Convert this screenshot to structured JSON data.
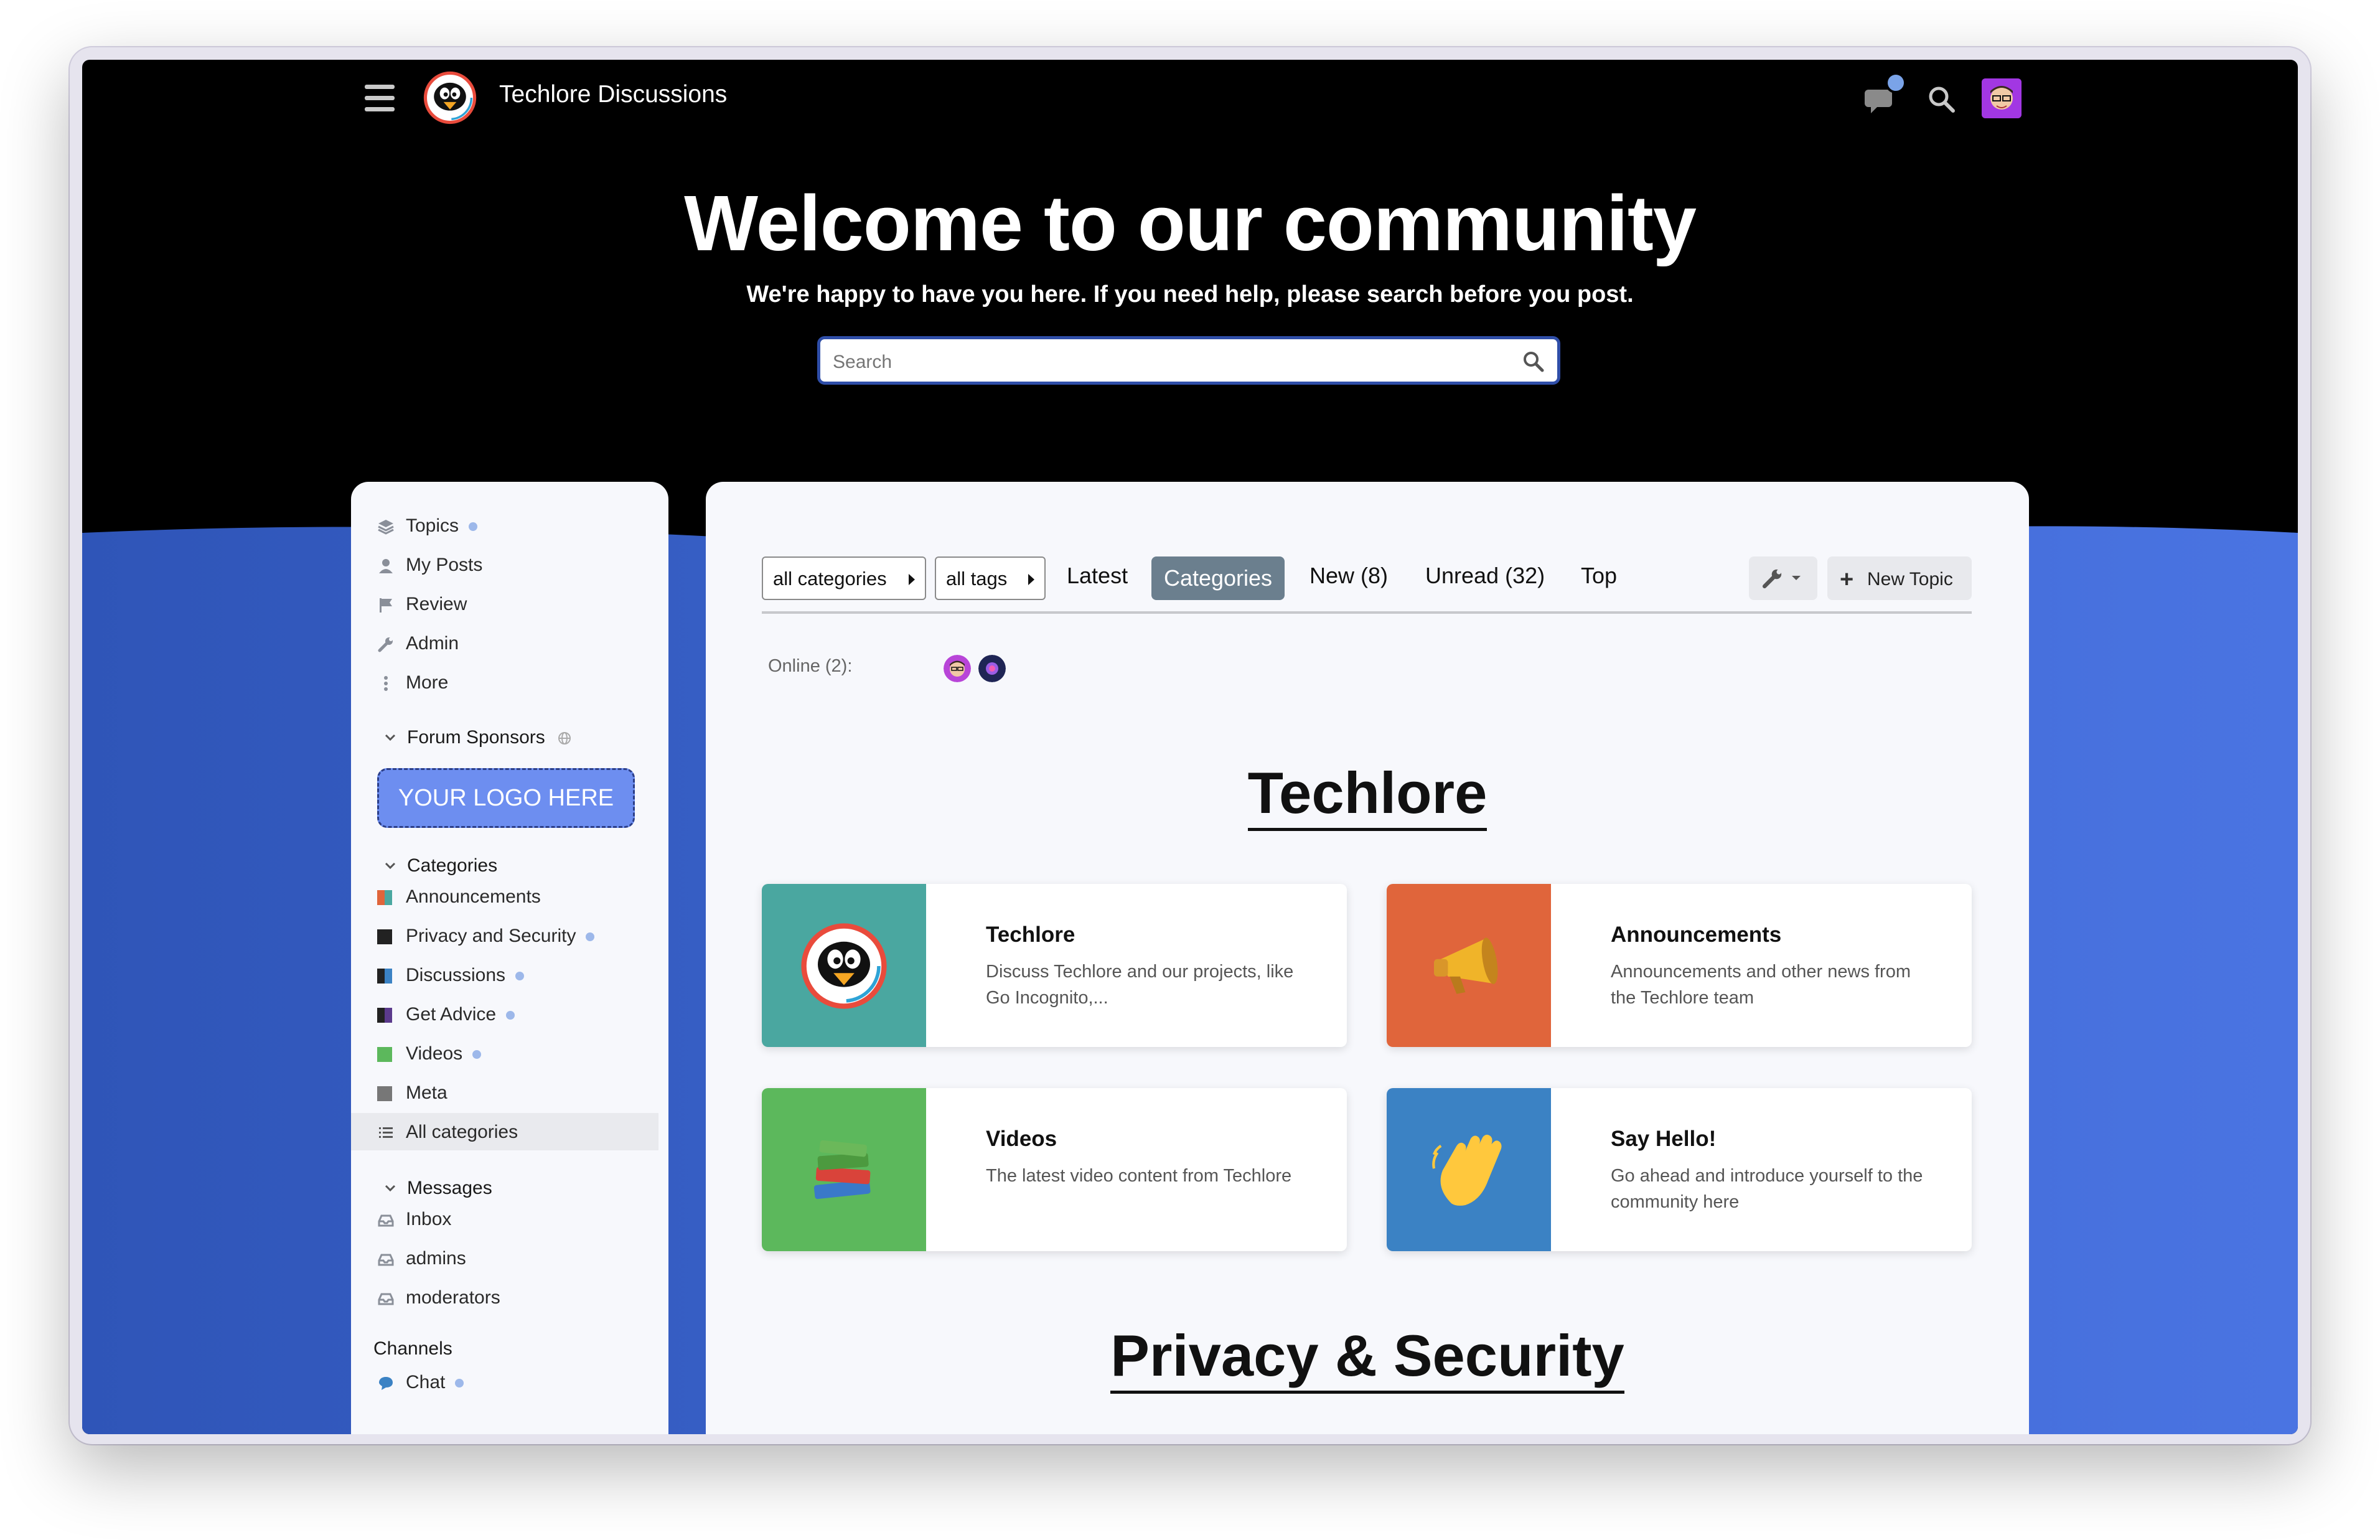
{
  "header": {
    "site_title": "Techlore Discussions"
  },
  "banner": {
    "title": "Welcome to our community",
    "subtitle": "We're happy to have you here. If you need help, please search before you post.",
    "search_placeholder": "Search"
  },
  "sidebar": {
    "top_items": [
      {
        "label": "Topics"
      },
      {
        "label": "My Posts"
      },
      {
        "label": "Review"
      },
      {
        "label": "Admin"
      },
      {
        "label": "More"
      }
    ],
    "sponsors_heading": "Forum Sponsors",
    "logo_promo": "YOUR LOGO HERE",
    "categories_heading": "Categories",
    "categories": [
      {
        "label": "Announcements",
        "color": "#e0653b"
      },
      {
        "label": "Privacy and Security",
        "color": "#222222"
      },
      {
        "label": "Discussions",
        "color": "#3b82c4"
      },
      {
        "label": "Get Advice",
        "color": "#5b3a8c"
      },
      {
        "label": "Videos",
        "color": "#5cb85c"
      },
      {
        "label": "Meta",
        "color": "#777777"
      }
    ],
    "all_categories": "All categories",
    "messages_heading": "Messages",
    "messages": [
      {
        "label": "Inbox"
      },
      {
        "label": "admins"
      },
      {
        "label": "moderators"
      }
    ],
    "channels_heading": "Channels",
    "channels": [
      {
        "label": "Chat"
      }
    ]
  },
  "nav": {
    "all_categories": "all categories",
    "all_tags": "all tags",
    "tabs": [
      "Latest",
      "Categories",
      "New (8)",
      "Unread (32)",
      "Top"
    ],
    "active_tab": "Categories",
    "new_topic": "New Topic"
  },
  "online": {
    "label": "Online (2):"
  },
  "sections": [
    {
      "title": "Techlore",
      "cards": [
        {
          "title": "Techlore",
          "description": "Discuss Techlore and our projects, like Go Incognito,...",
          "color": "#4aa7a0",
          "icon": "penguin-icon"
        },
        {
          "title": "Announcements",
          "description": "Announcements and other news from the Techlore team",
          "color": "#e0653b",
          "icon": "megaphone-icon"
        },
        {
          "title": "Videos",
          "description": "The latest video content from Techlore",
          "color": "#5cb85c",
          "icon": "books-icon"
        },
        {
          "title": "Say Hello!",
          "description": "Go ahead and introduce yourself to the community here",
          "color": "#3b82c4",
          "icon": "waving-hand-icon"
        }
      ]
    },
    {
      "title": "Privacy & Security"
    }
  ],
  "colors": {
    "accent_blue": "#3f63cf",
    "header_bg": "#000000"
  }
}
